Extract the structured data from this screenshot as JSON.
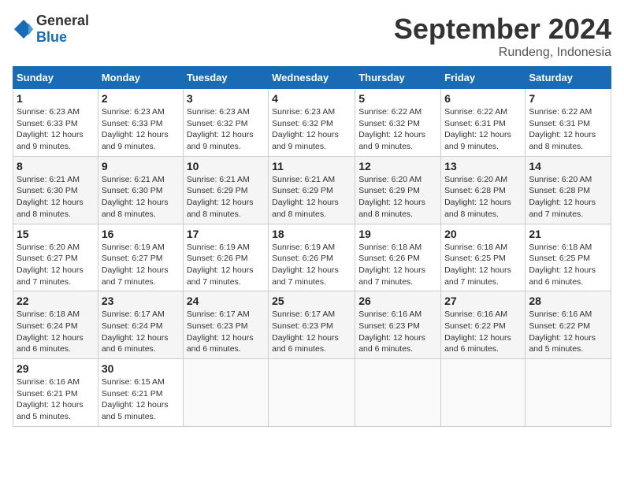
{
  "header": {
    "logo_general": "General",
    "logo_blue": "Blue",
    "month_title": "September 2024",
    "location": "Rundeng, Indonesia"
  },
  "weekdays": [
    "Sunday",
    "Monday",
    "Tuesday",
    "Wednesday",
    "Thursday",
    "Friday",
    "Saturday"
  ],
  "weeks": [
    [
      {
        "day": "1",
        "sunrise": "Sunrise: 6:23 AM",
        "sunset": "Sunset: 6:33 PM",
        "daylight": "Daylight: 12 hours and 9 minutes."
      },
      {
        "day": "2",
        "sunrise": "Sunrise: 6:23 AM",
        "sunset": "Sunset: 6:33 PM",
        "daylight": "Daylight: 12 hours and 9 minutes."
      },
      {
        "day": "3",
        "sunrise": "Sunrise: 6:23 AM",
        "sunset": "Sunset: 6:32 PM",
        "daylight": "Daylight: 12 hours and 9 minutes."
      },
      {
        "day": "4",
        "sunrise": "Sunrise: 6:23 AM",
        "sunset": "Sunset: 6:32 PM",
        "daylight": "Daylight: 12 hours and 9 minutes."
      },
      {
        "day": "5",
        "sunrise": "Sunrise: 6:22 AM",
        "sunset": "Sunset: 6:32 PM",
        "daylight": "Daylight: 12 hours and 9 minutes."
      },
      {
        "day": "6",
        "sunrise": "Sunrise: 6:22 AM",
        "sunset": "Sunset: 6:31 PM",
        "daylight": "Daylight: 12 hours and 9 minutes."
      },
      {
        "day": "7",
        "sunrise": "Sunrise: 6:22 AM",
        "sunset": "Sunset: 6:31 PM",
        "daylight": "Daylight: 12 hours and 8 minutes."
      }
    ],
    [
      {
        "day": "8",
        "sunrise": "Sunrise: 6:21 AM",
        "sunset": "Sunset: 6:30 PM",
        "daylight": "Daylight: 12 hours and 8 minutes."
      },
      {
        "day": "9",
        "sunrise": "Sunrise: 6:21 AM",
        "sunset": "Sunset: 6:30 PM",
        "daylight": "Daylight: 12 hours and 8 minutes."
      },
      {
        "day": "10",
        "sunrise": "Sunrise: 6:21 AM",
        "sunset": "Sunset: 6:29 PM",
        "daylight": "Daylight: 12 hours and 8 minutes."
      },
      {
        "day": "11",
        "sunrise": "Sunrise: 6:21 AM",
        "sunset": "Sunset: 6:29 PM",
        "daylight": "Daylight: 12 hours and 8 minutes."
      },
      {
        "day": "12",
        "sunrise": "Sunrise: 6:20 AM",
        "sunset": "Sunset: 6:29 PM",
        "daylight": "Daylight: 12 hours and 8 minutes."
      },
      {
        "day": "13",
        "sunrise": "Sunrise: 6:20 AM",
        "sunset": "Sunset: 6:28 PM",
        "daylight": "Daylight: 12 hours and 8 minutes."
      },
      {
        "day": "14",
        "sunrise": "Sunrise: 6:20 AM",
        "sunset": "Sunset: 6:28 PM",
        "daylight": "Daylight: 12 hours and 7 minutes."
      }
    ],
    [
      {
        "day": "15",
        "sunrise": "Sunrise: 6:20 AM",
        "sunset": "Sunset: 6:27 PM",
        "daylight": "Daylight: 12 hours and 7 minutes."
      },
      {
        "day": "16",
        "sunrise": "Sunrise: 6:19 AM",
        "sunset": "Sunset: 6:27 PM",
        "daylight": "Daylight: 12 hours and 7 minutes."
      },
      {
        "day": "17",
        "sunrise": "Sunrise: 6:19 AM",
        "sunset": "Sunset: 6:26 PM",
        "daylight": "Daylight: 12 hours and 7 minutes."
      },
      {
        "day": "18",
        "sunrise": "Sunrise: 6:19 AM",
        "sunset": "Sunset: 6:26 PM",
        "daylight": "Daylight: 12 hours and 7 minutes."
      },
      {
        "day": "19",
        "sunrise": "Sunrise: 6:18 AM",
        "sunset": "Sunset: 6:26 PM",
        "daylight": "Daylight: 12 hours and 7 minutes."
      },
      {
        "day": "20",
        "sunrise": "Sunrise: 6:18 AM",
        "sunset": "Sunset: 6:25 PM",
        "daylight": "Daylight: 12 hours and 7 minutes."
      },
      {
        "day": "21",
        "sunrise": "Sunrise: 6:18 AM",
        "sunset": "Sunset: 6:25 PM",
        "daylight": "Daylight: 12 hours and 6 minutes."
      }
    ],
    [
      {
        "day": "22",
        "sunrise": "Sunrise: 6:18 AM",
        "sunset": "Sunset: 6:24 PM",
        "daylight": "Daylight: 12 hours and 6 minutes."
      },
      {
        "day": "23",
        "sunrise": "Sunrise: 6:17 AM",
        "sunset": "Sunset: 6:24 PM",
        "daylight": "Daylight: 12 hours and 6 minutes."
      },
      {
        "day": "24",
        "sunrise": "Sunrise: 6:17 AM",
        "sunset": "Sunset: 6:23 PM",
        "daylight": "Daylight: 12 hours and 6 minutes."
      },
      {
        "day": "25",
        "sunrise": "Sunrise: 6:17 AM",
        "sunset": "Sunset: 6:23 PM",
        "daylight": "Daylight: 12 hours and 6 minutes."
      },
      {
        "day": "26",
        "sunrise": "Sunrise: 6:16 AM",
        "sunset": "Sunset: 6:23 PM",
        "daylight": "Daylight: 12 hours and 6 minutes."
      },
      {
        "day": "27",
        "sunrise": "Sunrise: 6:16 AM",
        "sunset": "Sunset: 6:22 PM",
        "daylight": "Daylight: 12 hours and 6 minutes."
      },
      {
        "day": "28",
        "sunrise": "Sunrise: 6:16 AM",
        "sunset": "Sunset: 6:22 PM",
        "daylight": "Daylight: 12 hours and 5 minutes."
      }
    ],
    [
      {
        "day": "29",
        "sunrise": "Sunrise: 6:16 AM",
        "sunset": "Sunset: 6:21 PM",
        "daylight": "Daylight: 12 hours and 5 minutes."
      },
      {
        "day": "30",
        "sunrise": "Sunrise: 6:15 AM",
        "sunset": "Sunset: 6:21 PM",
        "daylight": "Daylight: 12 hours and 5 minutes."
      },
      null,
      null,
      null,
      null,
      null
    ]
  ]
}
